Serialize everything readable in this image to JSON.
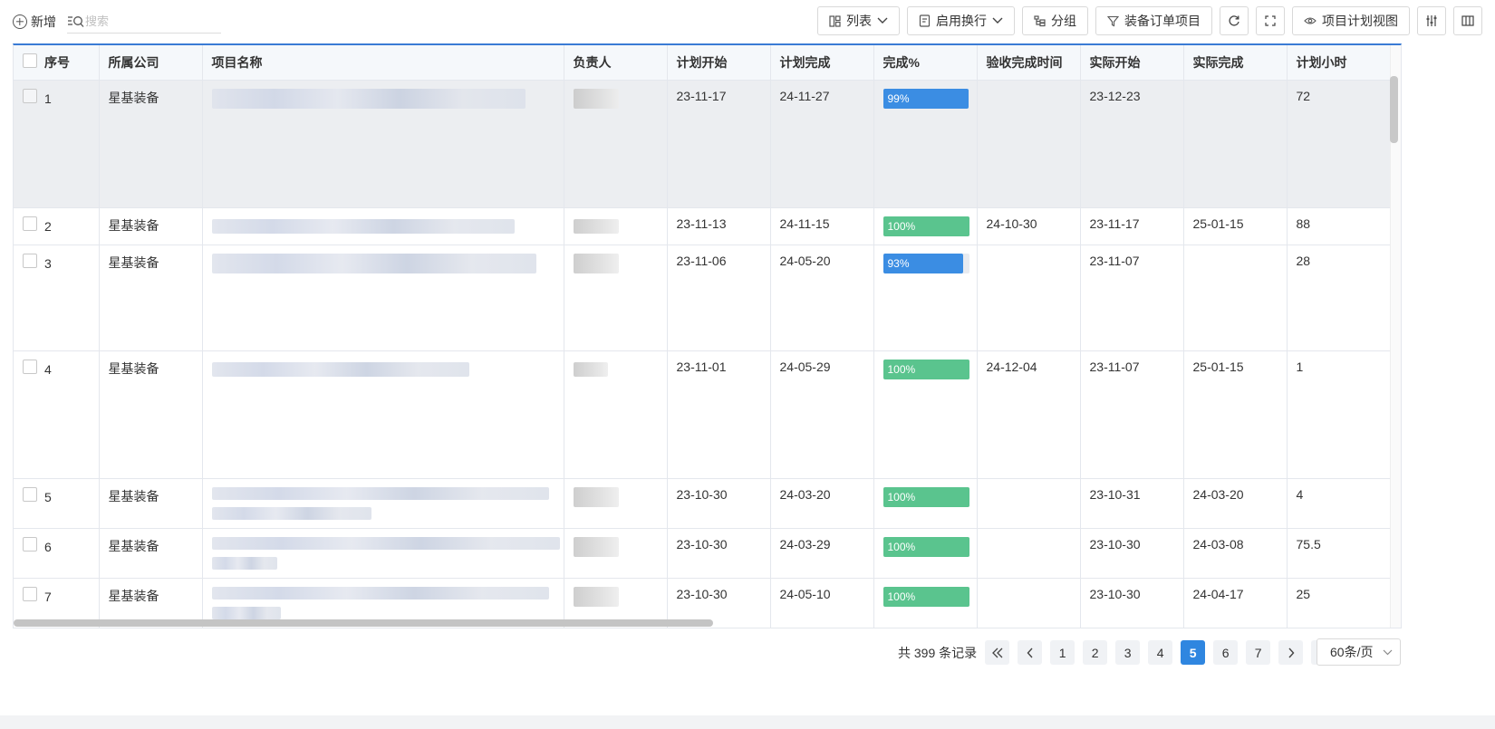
{
  "toolbar": {
    "new_label": "新增",
    "search_placeholder": "搜索",
    "buttons": {
      "list": "列表",
      "wrap": "启用换行",
      "group": "分组",
      "filter": "装备订单项目",
      "plan_view": "项目计划视图"
    }
  },
  "table": {
    "headers": [
      "序号",
      "所属公司",
      "项目名称",
      "负责人",
      "计划开始",
      "计划完成",
      "完成%",
      "验收完成时间",
      "实际开始",
      "实际完成",
      "计划小时"
    ],
    "rows": [
      {
        "seq": "1",
        "company": "星基装备",
        "plan_start": "23-11-17",
        "plan_end": "24-11-27",
        "pct": 99,
        "pct_label": "99%",
        "accept": "",
        "actual_start": "23-12-23",
        "actual_end": "",
        "hours": "72"
      },
      {
        "seq": "2",
        "company": "星基装备",
        "plan_start": "23-11-13",
        "plan_end": "24-11-15",
        "pct": 100,
        "pct_label": "100%",
        "accept": "24-10-30",
        "actual_start": "23-11-17",
        "actual_end": "25-01-15",
        "hours": "88"
      },
      {
        "seq": "3",
        "company": "星基装备",
        "plan_start": "23-11-06",
        "plan_end": "24-05-20",
        "pct": 93,
        "pct_label": "93%",
        "accept": "",
        "actual_start": "23-11-07",
        "actual_end": "",
        "hours": "28"
      },
      {
        "seq": "4",
        "company": "星基装备",
        "plan_start": "23-11-01",
        "plan_end": "24-05-29",
        "pct": 100,
        "pct_label": "100%",
        "accept": "24-12-04",
        "actual_start": "23-11-07",
        "actual_end": "25-01-15",
        "hours": "1"
      },
      {
        "seq": "5",
        "company": "星基装备",
        "plan_start": "23-10-30",
        "plan_end": "24-03-20",
        "pct": 100,
        "pct_label": "100%",
        "accept": "",
        "actual_start": "23-10-31",
        "actual_end": "24-03-20",
        "hours": "4"
      },
      {
        "seq": "6",
        "company": "星基装备",
        "plan_start": "23-10-30",
        "plan_end": "24-03-29",
        "pct": 100,
        "pct_label": "100%",
        "accept": "",
        "actual_start": "23-10-30",
        "actual_end": "24-03-08",
        "hours": "75.5"
      },
      {
        "seq": "7",
        "company": "星基装备",
        "plan_start": "23-10-30",
        "plan_end": "24-05-10",
        "pct": 100,
        "pct_label": "100%",
        "accept": "",
        "actual_start": "23-10-30",
        "actual_end": "24-04-17",
        "hours": "25"
      }
    ]
  },
  "pagination": {
    "total": "共 399 条记录",
    "pages": [
      "1",
      "2",
      "3",
      "4",
      "5",
      "6",
      "7"
    ],
    "current": "5",
    "page_size": "60条/页"
  },
  "colors": {
    "accent": "#2f86e0",
    "progress_blue": "#3b8de3",
    "progress_green": "#5ac48e",
    "selected_row": "#eceef1"
  }
}
